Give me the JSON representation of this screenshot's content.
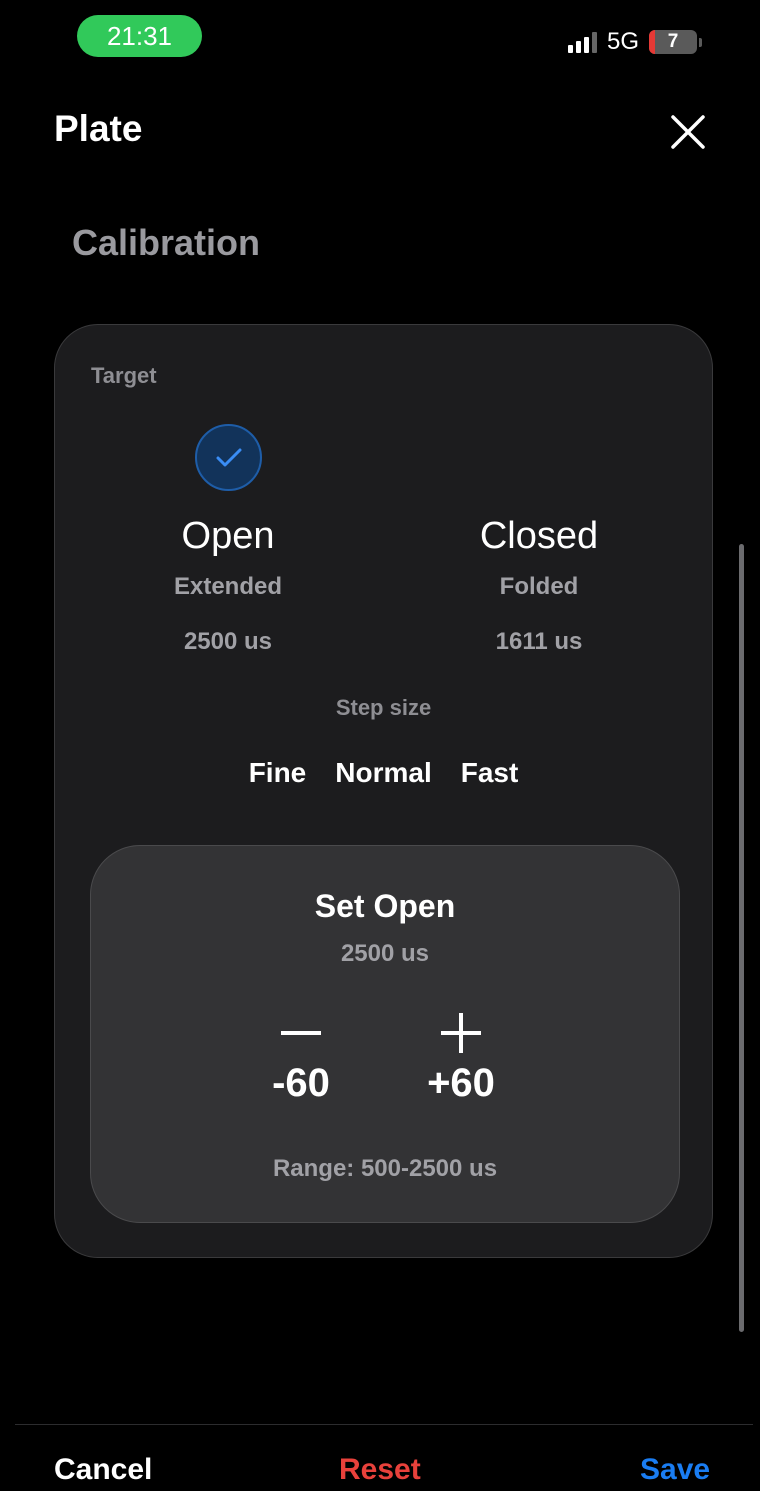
{
  "status_bar": {
    "time": "21:31",
    "network": "5G",
    "battery_level": "7",
    "signal_bars_active": 3,
    "signal_bars_total": 4,
    "time_pill_color": "#31c95a"
  },
  "header": {
    "title": "Plate",
    "close_icon": "close-icon"
  },
  "section": {
    "title": "Calibration"
  },
  "target": {
    "label": "Target",
    "selected": "open",
    "open": {
      "name": "Open",
      "state": "Extended",
      "value": "2500 us"
    },
    "closed": {
      "name": "Closed",
      "state": "Folded",
      "value": "1611 us"
    }
  },
  "step_size": {
    "label": "Step size",
    "options": [
      "Fine",
      "Normal",
      "Fast"
    ]
  },
  "adjust": {
    "title": "Set Open",
    "value": "2500 us",
    "minus_label": "-60",
    "plus_label": "+60",
    "range": "Range: 500-2500 us"
  },
  "footer": {
    "cancel": "Cancel",
    "reset": "Reset",
    "save": "Save"
  },
  "colors": {
    "accent_blue": "#1a7df2",
    "reset_red": "#e8413b",
    "card_bg": "#1c1c1e",
    "panel_bg": "#333335"
  }
}
